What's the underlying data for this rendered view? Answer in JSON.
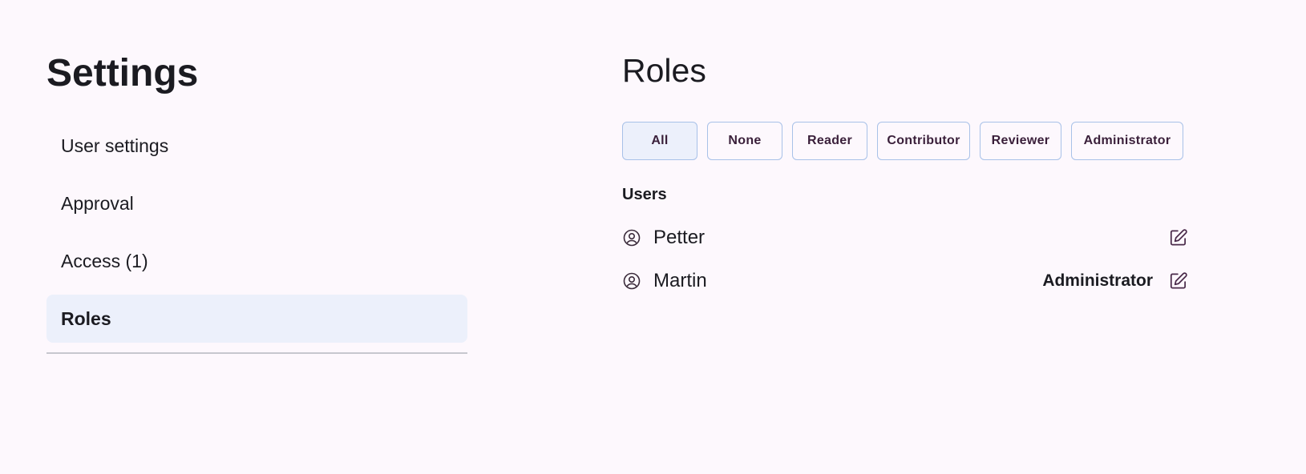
{
  "page": {
    "title": "Settings"
  },
  "nav": {
    "items": [
      {
        "label": "User settings",
        "active": false
      },
      {
        "label": "Approval",
        "active": false
      },
      {
        "label": "Access (1)",
        "active": false
      },
      {
        "label": "Roles",
        "active": true
      }
    ]
  },
  "roles": {
    "title": "Roles",
    "filters": [
      {
        "label": "All",
        "selected": true
      },
      {
        "label": "None",
        "selected": false
      },
      {
        "label": "Reader",
        "selected": false
      },
      {
        "label": "Contributor",
        "selected": false
      },
      {
        "label": "Reviewer",
        "selected": false
      },
      {
        "label": "Administrator",
        "selected": false
      }
    ],
    "users_heading": "Users",
    "users": [
      {
        "name": "Petter",
        "role": "",
        "avatar_icon": "account-circle-icon",
        "edit_icon": "edit-icon"
      },
      {
        "name": "Martin",
        "role": "Administrator",
        "avatar_icon": "account-circle-icon",
        "edit_icon": "edit-icon"
      }
    ]
  },
  "colors": {
    "background": "#fdf8fd",
    "active_nav_bg": "#ecf0fb",
    "chip_border": "#a8c1e8",
    "text": "#1b1b21"
  }
}
